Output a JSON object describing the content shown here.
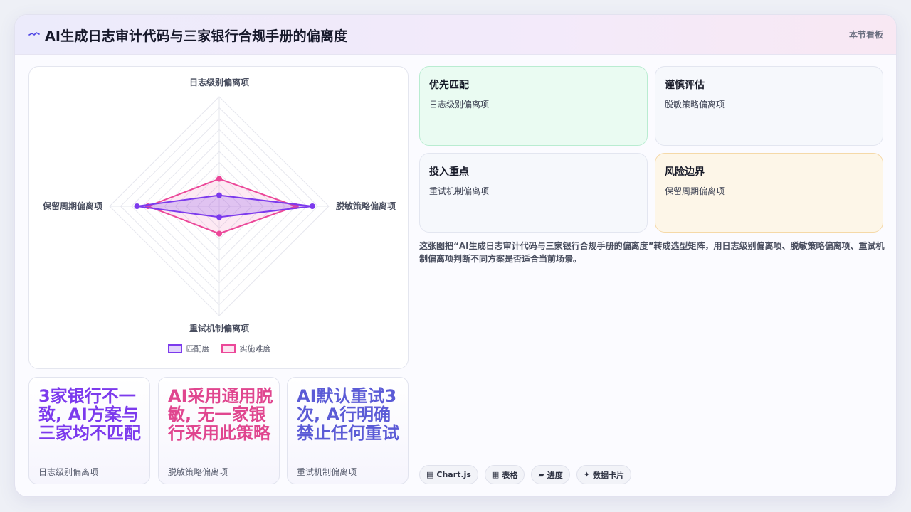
{
  "header": {
    "title": "AI生成日志审计代码与三家银行合规手册的偏离度",
    "right_label": "本节看板",
    "icon": "wave-icon"
  },
  "chart_data": {
    "type": "radar",
    "axes": [
      "日志级别偏离项",
      "脱敏策略偏离项",
      "重试机制偏离项",
      "保留周期偏离项"
    ],
    "series": [
      {
        "name": "匹配度",
        "values": [
          1,
          8.5,
          1,
          7.5
        ],
        "color": "#7c3aed"
      },
      {
        "name": "实施难度",
        "values": [
          2.5,
          7.0,
          2.5,
          6.5
        ],
        "color": "#ec4899"
      }
    ],
    "r_range": [
      0,
      10
    ],
    "grid": true,
    "legend_position": "bottom"
  },
  "stats": [
    {
      "big": "3家银行不一致, AI方案与三家均不匹配",
      "sub": "日志级别偏离项",
      "color": "#7c3aed"
    },
    {
      "big": "AI采用通用脱敏, 无一家银行采用此策略",
      "sub": "脱敏策略偏离项",
      "color": "#e0468f"
    },
    {
      "big": "AI默认重试3次, A行明确禁止任何重试",
      "sub": "重试机制偏离项",
      "color": "#5b5bd6"
    }
  ],
  "quadrants": [
    {
      "title": "优先匹配",
      "sub": "日志级别偏离项",
      "bg": "#eafbf2",
      "border": "#b9ecd1"
    },
    {
      "title": "谨慎评估",
      "sub": "脱敏策略偏离项",
      "bg": "#f6f8fc",
      "border": "#e3e6f0"
    },
    {
      "title": "投入重点",
      "sub": "重试机制偏离项",
      "bg": "#f6f8fc",
      "border": "#e3e6f0"
    },
    {
      "title": "风险边界",
      "sub": "保留周期偏离项",
      "bg": "#fdf6e8",
      "border": "#f5d9a8"
    }
  ],
  "description": "这张图把“AI生成日志审计代码与三家银行合规手册的偏离度”转成选型矩阵，用日志级别偏离项、脱敏策略偏离项、重试机制偏离项判断不同方案是否适合当前场景。",
  "tags": [
    {
      "icon": "chart-icon",
      "glyph": "▤",
      "label": "Chart.js"
    },
    {
      "icon": "table-icon",
      "glyph": "▦",
      "label": "表格"
    },
    {
      "icon": "progress-icon",
      "glyph": "▰",
      "label": "进度"
    },
    {
      "icon": "sparkle-icon",
      "glyph": "✦",
      "label": "数据卡片"
    }
  ]
}
